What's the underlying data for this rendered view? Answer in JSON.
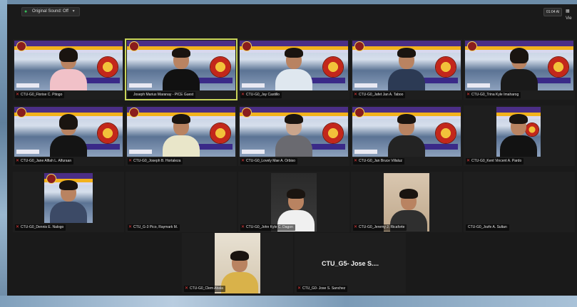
{
  "topbar": {
    "sound_label": "Original Sound: Off",
    "zoom_label": "01:04 AI",
    "view_label": "Vie"
  },
  "participants": [
    {
      "name": "CTU-G0_Florise C. Pitogo"
    },
    {
      "name": "Joseph Marius Maranay - PICE Guest"
    },
    {
      "name": "CTU-G0_Jay Castillo"
    },
    {
      "name": "CTU-G0_Jafet Jan A. Taboo"
    },
    {
      "name": "CTU-G0_Trina Kyle Imaharog"
    },
    {
      "name": "CTU-G0_Jane Alfiah L. Alfuraan"
    },
    {
      "name": "CTU-G0_Joseph B. Hortaleza"
    },
    {
      "name": "CTU-G0_Lovely Mae A. Orbiso"
    },
    {
      "name": "CTU-G0_Jan Bruce Villaluz"
    },
    {
      "name": "CTU-G0_Kent Vincent A. Pardo"
    },
    {
      "name": "CTU-G0_Dennis E. Nalogo"
    },
    {
      "name": "CTU_G-3 Pico, Raymark M."
    },
    {
      "name": "CTU-G0_John Kyle C. Dagon"
    },
    {
      "name": "CTU-G0_Jeremy J. Ricaforte"
    },
    {
      "name": "CTU-G0_Jozfe A. Sultan"
    },
    {
      "name": "CTU-G0_Clem Abala"
    },
    {
      "name": "CTU_G0- Jose S. Sanchez",
      "big_label": "CTU_G5- Jose S...."
    }
  ]
}
